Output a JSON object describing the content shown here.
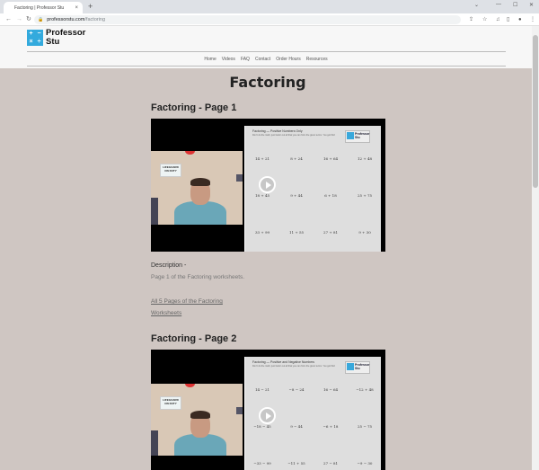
{
  "browser": {
    "tab_title": "Factoring | Professor Stu",
    "tab_close": "×",
    "new_tab": "+",
    "url_host": "professorstu.com",
    "url_path": "/factoring",
    "lock_icon": "🔒",
    "back": "←",
    "forward": "→",
    "reload": "↻",
    "controls": {
      "dropdown": "⌄",
      "minimize": "—",
      "maximize": "☐",
      "close": "✕"
    },
    "toolbar_icons": {
      "share": "⇪",
      "star": "☆",
      "media": "♫",
      "sidepanel": "▯",
      "profile": "●",
      "menu": "⋮"
    }
  },
  "site": {
    "logo_glyphs": [
      "+",
      "−",
      "×",
      "÷"
    ],
    "logo_line1": "Professor",
    "logo_line2": "Stu",
    "nav": [
      "Home",
      "Videos",
      "FAQ",
      "Contact",
      "Order Hours",
      "Resources"
    ]
  },
  "page": {
    "title": "Factoring",
    "sections": [
      {
        "title": "Factoring - Page 1",
        "video": {
          "sign_text": "LIFEGUARD ON DUTY",
          "worksheet_title": "Factoring — Positive Numbers Only",
          "worksheet_subtitle": "Don't do the math, just factor out all that you can from the given terms. You got this!",
          "worksheet_logo": "Professor Stu",
          "problems": [
            "14 + 21",
            "8 + 24",
            "16 + 64",
            "12 + 48",
            "18 + 45",
            "9 + 44",
            "6 + 18",
            "25 + 75",
            "33 + 99",
            "11 + 55",
            "27 + 81",
            "9 + 30"
          ]
        },
        "description_label": "Description -",
        "description_text": "Page 1 of the Factoring worksheets.",
        "link_text": "All 5 Pages of the Factoring Worksheets"
      },
      {
        "title": "Factoring - Page 2",
        "video": {
          "sign_text": "LIFEGUARD ON DUTY",
          "worksheet_title": "Factoring — Positive and Negative Numbers",
          "worksheet_subtitle": "Don't do the math, just factor out all that you can from the given terms. You got this!",
          "worksheet_logo": "Professor Stu",
          "problems": [
            "14 − 21",
            "−8 − 24",
            "16 − 64",
            "−12 + 48",
            "−18 − 45",
            "9 − 44",
            "−6 + 18",
            "25 − 75",
            "−33 − 99",
            "−11 + 55",
            "27 − 81",
            "−9 − 30"
          ]
        }
      }
    ]
  }
}
